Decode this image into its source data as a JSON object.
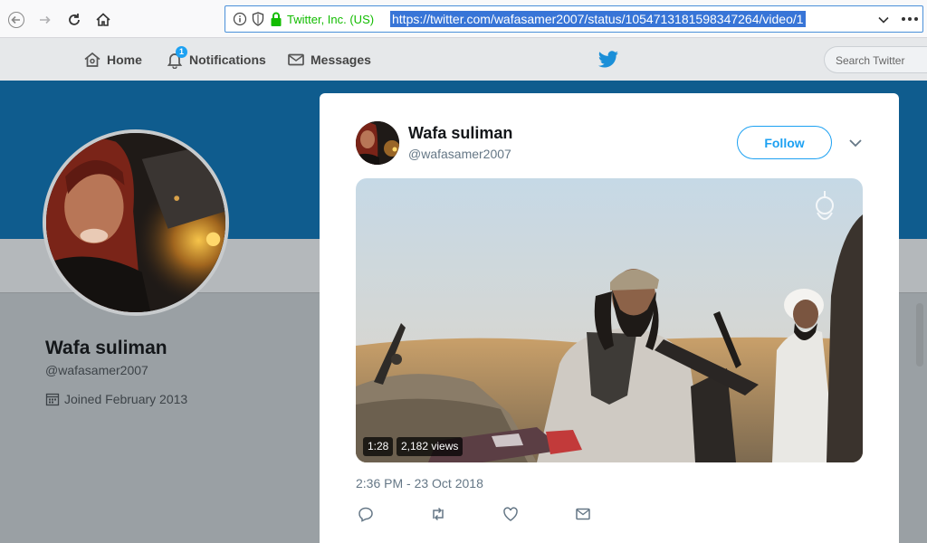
{
  "browser": {
    "site_identity": "Twitter, Inc. (US)",
    "url": "https://twitter.com/wafasamer2007/status/1054713181598347264/video/1"
  },
  "twitter_nav": {
    "home_label": "Home",
    "notifications_label": "Notifications",
    "notifications_count": "1",
    "messages_label": "Messages",
    "search_placeholder": "Search Twitter"
  },
  "profile": {
    "name": "Wafa suliman",
    "handle": "@wafasamer2007",
    "joined": "Joined February 2013"
  },
  "tweet": {
    "author_name": "Wafa suliman",
    "author_handle": "@wafasamer2007",
    "follow_label": "Follow",
    "video_duration": "1:28",
    "video_views": "2,182 views",
    "timestamp": "2:36 PM - 23 Oct 2018"
  },
  "colors": {
    "twitter_blue": "#1da1f2",
    "banner": "#0f5c8e",
    "url_highlight": "#3875d7",
    "secure_green": "#12bc00"
  },
  "icons": [
    "back-icon",
    "forward-icon",
    "reload-icon",
    "home-icon",
    "info-icon",
    "tracking-shield-icon",
    "lock-icon",
    "dropdown-chevron-icon",
    "more-icon",
    "twitter-home-icon",
    "bell-icon",
    "envelope-icon",
    "twitter-bird-icon",
    "calendar-icon",
    "caret-down-icon",
    "reply-icon",
    "retweet-icon",
    "like-icon",
    "direct-message-icon"
  ]
}
